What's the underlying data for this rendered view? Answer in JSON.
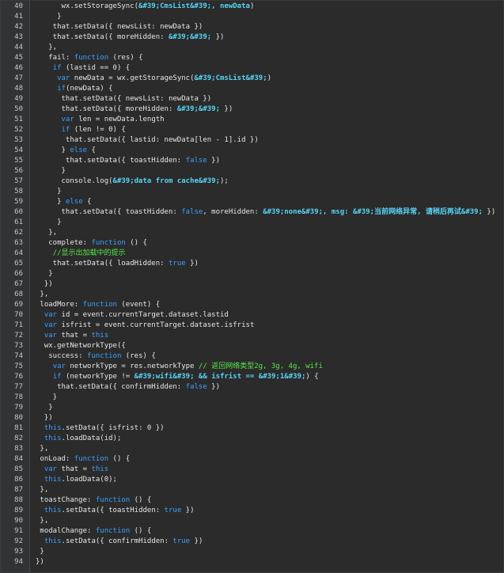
{
  "colors": {
    "background": "#2b2b2b",
    "gutter": "#313335",
    "plain": "#e6e6e6",
    "keyword": "#3aa0ff",
    "string": "#58d4f5",
    "comment": "#57e84a",
    "line_number": "#c6c6c6"
  },
  "lines": [
    {
      "n": "40",
      "t": [
        [
          "p",
          "      wx.setStorageSync("
        ],
        [
          "s",
          "&#39;CmsList&#39;, newData"
        ],
        [
          "p",
          ")"
        ]
      ]
    },
    {
      "n": "41",
      "t": [
        [
          "p",
          "     }"
        ]
      ]
    },
    {
      "n": "42",
      "t": [
        [
          "p",
          "    that.setData({ newsList: newData })"
        ]
      ]
    },
    {
      "n": "43",
      "t": [
        [
          "p",
          "    that.setData({ moreHidden: "
        ],
        [
          "s",
          "&#39;&#39;"
        ],
        [
          "p",
          " })"
        ]
      ]
    },
    {
      "n": "44",
      "t": [
        [
          "p",
          "   },"
        ]
      ]
    },
    {
      "n": "45",
      "t": [
        [
          "p",
          "   fail: "
        ],
        [
          "k",
          "function"
        ],
        [
          "p",
          " (res) {"
        ]
      ]
    },
    {
      "n": "46",
      "t": [
        [
          "p",
          "    "
        ],
        [
          "k",
          "if"
        ],
        [
          "p",
          " (lastid == 0) {"
        ]
      ]
    },
    {
      "n": "47",
      "t": [
        [
          "p",
          "     "
        ],
        [
          "k",
          "var"
        ],
        [
          "p",
          " newData = wx.getStorageSync("
        ],
        [
          "s",
          "&#39;CmsList&#39;"
        ],
        [
          "p",
          ")"
        ]
      ]
    },
    {
      "n": "48",
      "t": [
        [
          "p",
          "     "
        ],
        [
          "k",
          "if"
        ],
        [
          "p",
          "(newData) {"
        ]
      ]
    },
    {
      "n": "49",
      "t": [
        [
          "p",
          "      that.setData({ newsList: newData })"
        ]
      ]
    },
    {
      "n": "50",
      "t": [
        [
          "p",
          "      that.setData({ moreHidden: "
        ],
        [
          "s",
          "&#39;&#39;"
        ],
        [
          "p",
          " })"
        ]
      ]
    },
    {
      "n": "51",
      "t": [
        [
          "p",
          "      "
        ],
        [
          "k",
          "var"
        ],
        [
          "p",
          " len = newData.length"
        ]
      ]
    },
    {
      "n": "52",
      "t": [
        [
          "p",
          "      "
        ],
        [
          "k",
          "if"
        ],
        [
          "p",
          " (len != 0) {"
        ]
      ]
    },
    {
      "n": "53",
      "t": [
        [
          "p",
          "       that.setData({ lastid: newData[len - 1].id })"
        ]
      ]
    },
    {
      "n": "54",
      "t": [
        [
          "p",
          "      } "
        ],
        [
          "k",
          "else"
        ],
        [
          "p",
          " {"
        ]
      ]
    },
    {
      "n": "55",
      "t": [
        [
          "p",
          "       that.setData({ toastHidden: "
        ],
        [
          "k",
          "false"
        ],
        [
          "p",
          " })"
        ]
      ]
    },
    {
      "n": "56",
      "t": [
        [
          "p",
          "      }"
        ]
      ]
    },
    {
      "n": "57",
      "t": [
        [
          "p",
          "      console.log("
        ],
        [
          "s",
          "&#39;data from cache&#39;"
        ],
        [
          "p",
          ");"
        ]
      ]
    },
    {
      "n": "58",
      "t": [
        [
          "p",
          "     }"
        ]
      ]
    },
    {
      "n": "59",
      "t": [
        [
          "p",
          "     } "
        ],
        [
          "k",
          "else"
        ],
        [
          "p",
          " {"
        ]
      ]
    },
    {
      "n": "60",
      "t": [
        [
          "p",
          "      that.setData({ toastHidden: "
        ],
        [
          "k",
          "false"
        ],
        [
          "p",
          ", moreHidden: "
        ],
        [
          "s",
          "&#39;none&#39;, msg: &#39;当前网络异常, 请稍后再试&#39;"
        ],
        [
          "p",
          " })"
        ]
      ]
    },
    {
      "n": "61",
      "t": [
        [
          "p",
          "     }"
        ]
      ]
    },
    {
      "n": "62",
      "t": [
        [
          "p",
          "   },"
        ]
      ]
    },
    {
      "n": "63",
      "t": [
        [
          "p",
          "   complete: "
        ],
        [
          "k",
          "function"
        ],
        [
          "p",
          " () {"
        ]
      ]
    },
    {
      "n": "64",
      "t": [
        [
          "p",
          "    "
        ],
        [
          "c",
          "//显示出加载中的提示"
        ]
      ]
    },
    {
      "n": "65",
      "t": [
        [
          "p",
          "    that.setData({ loadHidden: "
        ],
        [
          "k",
          "true"
        ],
        [
          "p",
          " })"
        ]
      ]
    },
    {
      "n": "66",
      "t": [
        [
          "p",
          "   }"
        ]
      ]
    },
    {
      "n": "67",
      "t": [
        [
          "p",
          "  })"
        ]
      ]
    },
    {
      "n": "68",
      "t": [
        [
          "p",
          " },"
        ]
      ]
    },
    {
      "n": "69",
      "t": [
        [
          "p",
          " loadMore: "
        ],
        [
          "k",
          "function"
        ],
        [
          "p",
          " (event) {"
        ]
      ]
    },
    {
      "n": "70",
      "t": [
        [
          "p",
          "  "
        ],
        [
          "k",
          "var"
        ],
        [
          "p",
          " id = event.currentTarget.dataset.lastid"
        ]
      ]
    },
    {
      "n": "71",
      "t": [
        [
          "p",
          "  "
        ],
        [
          "k",
          "var"
        ],
        [
          "p",
          " isfrist = event.currentTarget.dataset.isfrist"
        ]
      ]
    },
    {
      "n": "72",
      "t": [
        [
          "p",
          "  "
        ],
        [
          "k",
          "var"
        ],
        [
          "p",
          " that = "
        ],
        [
          "k",
          "this"
        ]
      ]
    },
    {
      "n": "73",
      "t": [
        [
          "p",
          "  wx.getNetworkType({"
        ]
      ]
    },
    {
      "n": "74",
      "t": [
        [
          "p",
          "   success: "
        ],
        [
          "k",
          "function"
        ],
        [
          "p",
          " (res) {"
        ]
      ]
    },
    {
      "n": "75",
      "t": [
        [
          "p",
          "    "
        ],
        [
          "k",
          "var"
        ],
        [
          "p",
          " networkType = res.networkType "
        ],
        [
          "c",
          "// 返回网络类型2g, 3g, 4g, wifi"
        ]
      ]
    },
    {
      "n": "76",
      "t": [
        [
          "p",
          "    "
        ],
        [
          "k",
          "if"
        ],
        [
          "p",
          " (networkType != "
        ],
        [
          "s",
          "&#39;wifi&#39; && isfrist == &#39;1&#39;"
        ],
        [
          "p",
          ") {"
        ]
      ]
    },
    {
      "n": "77",
      "t": [
        [
          "p",
          "     that.setData({ confirmHidden: "
        ],
        [
          "k",
          "false"
        ],
        [
          "p",
          " })"
        ]
      ]
    },
    {
      "n": "78",
      "t": [
        [
          "p",
          "    }"
        ]
      ]
    },
    {
      "n": "79",
      "t": [
        [
          "p",
          "   }"
        ]
      ]
    },
    {
      "n": "80",
      "t": [
        [
          "p",
          "  })"
        ]
      ]
    },
    {
      "n": "81",
      "t": [
        [
          "p",
          "  "
        ],
        [
          "k",
          "this"
        ],
        [
          "p",
          ".setData({ isfrist: 0 })"
        ]
      ]
    },
    {
      "n": "82",
      "t": [
        [
          "p",
          "  "
        ],
        [
          "k",
          "this"
        ],
        [
          "p",
          ".loadData(id);"
        ]
      ]
    },
    {
      "n": "83",
      "t": [
        [
          "p",
          " },"
        ]
      ]
    },
    {
      "n": "84",
      "t": [
        [
          "p",
          " onLoad: "
        ],
        [
          "k",
          "function"
        ],
        [
          "p",
          " () {"
        ]
      ]
    },
    {
      "n": "85",
      "t": [
        [
          "p",
          "  "
        ],
        [
          "k",
          "var"
        ],
        [
          "p",
          " that = "
        ],
        [
          "k",
          "this"
        ]
      ]
    },
    {
      "n": "86",
      "t": [
        [
          "p",
          "  "
        ],
        [
          "k",
          "this"
        ],
        [
          "p",
          ".loadData(0);"
        ]
      ]
    },
    {
      "n": "87",
      "t": [
        [
          "p",
          " },"
        ]
      ]
    },
    {
      "n": "88",
      "t": [
        [
          "p",
          " toastChange: "
        ],
        [
          "k",
          "function"
        ],
        [
          "p",
          " () {"
        ]
      ]
    },
    {
      "n": "89",
      "t": [
        [
          "p",
          "  "
        ],
        [
          "k",
          "this"
        ],
        [
          "p",
          ".setData({ toastHidden: "
        ],
        [
          "k",
          "true"
        ],
        [
          "p",
          " })"
        ]
      ]
    },
    {
      "n": "90",
      "t": [
        [
          "p",
          " },"
        ]
      ]
    },
    {
      "n": "91",
      "t": [
        [
          "p",
          " modalChange: "
        ],
        [
          "k",
          "function"
        ],
        [
          "p",
          " () {"
        ]
      ]
    },
    {
      "n": "92",
      "t": [
        [
          "p",
          "  "
        ],
        [
          "k",
          "this"
        ],
        [
          "p",
          ".setData({ confirmHidden: "
        ],
        [
          "k",
          "true"
        ],
        [
          "p",
          " })"
        ]
      ]
    },
    {
      "n": "93",
      "t": [
        [
          "p",
          " }"
        ]
      ]
    },
    {
      "n": "94",
      "t": [
        [
          "p",
          "})"
        ]
      ]
    }
  ]
}
